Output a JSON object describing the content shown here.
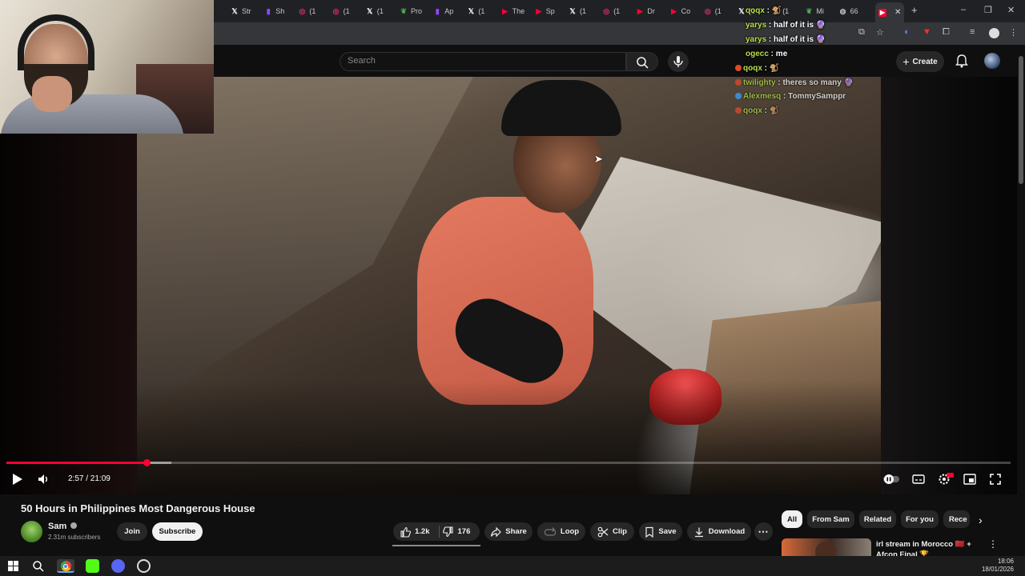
{
  "browser": {
    "tabs": [
      {
        "label": "Str",
        "icon": "x-icon",
        "color": "#ffffff"
      },
      {
        "label": "Sh",
        "icon": "twitch-icon",
        "color": "#9146ff"
      },
      {
        "label": "(1",
        "icon": "instagram-icon",
        "color": "#e1306c"
      },
      {
        "label": "(1",
        "icon": "instagram-icon",
        "color": "#e1306c"
      },
      {
        "label": "(1",
        "icon": "x-icon",
        "color": "#ffffff"
      },
      {
        "label": "Pro",
        "icon": "leaf-icon",
        "color": "#4caf50"
      },
      {
        "label": "Ap",
        "icon": "twitch-icon",
        "color": "#9146ff"
      },
      {
        "label": "(1",
        "icon": "x-icon",
        "color": "#ffffff"
      },
      {
        "label": "The",
        "icon": "youtube-icon",
        "color": "#ff0033"
      },
      {
        "label": "Sp",
        "icon": "youtube-icon",
        "color": "#ff0033"
      },
      {
        "label": "(1",
        "icon": "x-icon",
        "color": "#ffffff"
      },
      {
        "label": "(1",
        "icon": "instagram-icon",
        "color": "#e1306c"
      },
      {
        "label": "Dr",
        "icon": "youtube-icon",
        "color": "#ff0033"
      },
      {
        "label": "Co",
        "icon": "youtube-icon",
        "color": "#ff0033"
      },
      {
        "label": "(1",
        "icon": "instagram-icon",
        "color": "#e1306c"
      },
      {
        "label": "(1",
        "icon": "x-icon",
        "color": "#ffffff"
      },
      {
        "label": "(1",
        "icon": "x-icon",
        "color": "#ffffff"
      },
      {
        "label": "Mi",
        "icon": "leaf-icon",
        "color": "#4caf50"
      },
      {
        "label": "66",
        "icon": "globe-icon",
        "color": "#bbbbbb"
      }
    ],
    "new_tab": "+",
    "window_buttons": [
      "–",
      "❐",
      "✕"
    ]
  },
  "youtube": {
    "search_placeholder": "Search",
    "create_label": "Create"
  },
  "chat": [
    {
      "name": "qoqx",
      "msg": "🐒"
    },
    {
      "name": "yarys",
      "msg": "half of it is 🔮"
    },
    {
      "name": "yarys",
      "msg": "half of it is 🔮"
    },
    {
      "name": "ogecc",
      "msg": "me"
    },
    {
      "name": "qoqx",
      "msg": "🐒"
    },
    {
      "name": "twilighty",
      "msg": "theres so many 🔮"
    },
    {
      "name": "Alexmesq",
      "msg": "TommySamppr"
    },
    {
      "name": "qoqx",
      "msg": "🐒"
    }
  ],
  "player": {
    "time": "2:57 / 21:09",
    "progress": 0.1398,
    "buffered": 0.1643
  },
  "video": {
    "title": "50 Hours in Philippines Most Dangerous House",
    "channel": "Sam",
    "subscribers": "2.31m subscribers",
    "join": "Join",
    "subscribe": "Subscribe",
    "likes": "1.2k",
    "dislikes": "176",
    "share": "Share",
    "loop": "Loop",
    "clip": "Clip",
    "save": "Save",
    "download": "Download"
  },
  "chips": [
    "All",
    "From Sam",
    "Related",
    "For you",
    "Rece"
  ],
  "recommended": {
    "title": "irl stream in Morocco 🇲🇦 + Afcon Final 🏆"
  },
  "taskbar": {
    "time": "18:06",
    "date": "18/01/2026"
  }
}
